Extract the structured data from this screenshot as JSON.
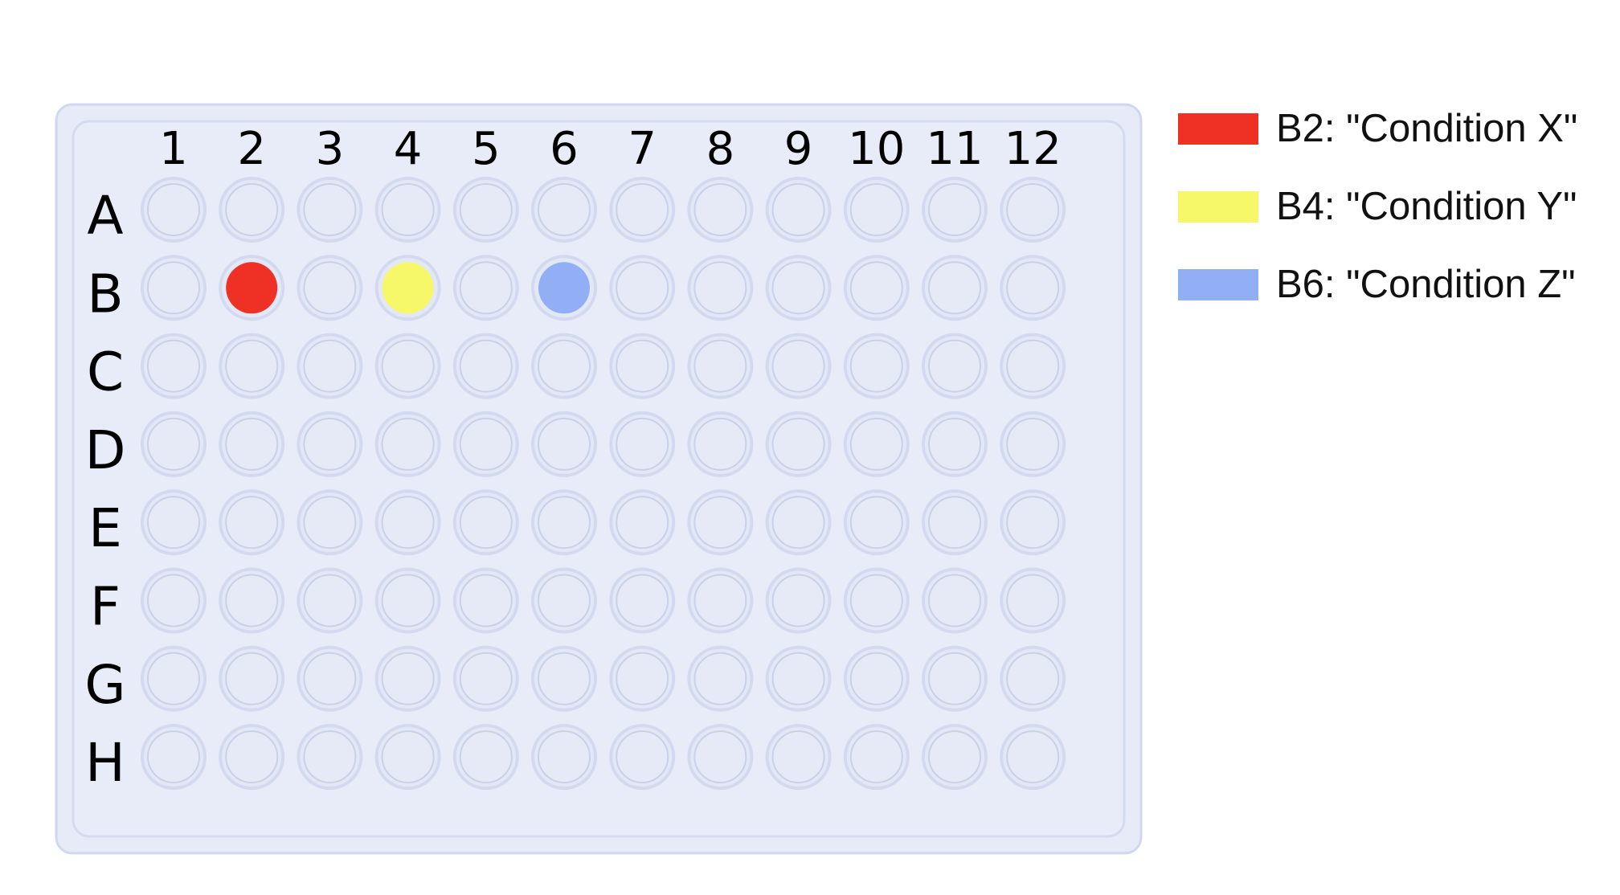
{
  "plate": {
    "columns": [
      "1",
      "2",
      "3",
      "4",
      "5",
      "6",
      "7",
      "8",
      "9",
      "10",
      "11",
      "12"
    ],
    "rows": [
      "A",
      "B",
      "C",
      "D",
      "E",
      "F",
      "G",
      "H"
    ],
    "empty_well_color": "#e6eaf6",
    "plate_color": "#e6ebf7",
    "plate_border_color": "#d0d8ee",
    "highlighted_wells": [
      {
        "well": "B2",
        "row": "B",
        "column": "2",
        "color": "#ee3124"
      },
      {
        "well": "B4",
        "row": "B",
        "column": "4",
        "color": "#f7f76a"
      },
      {
        "well": "B6",
        "row": "B",
        "column": "6",
        "color": "#92aff5"
      }
    ]
  },
  "legend": {
    "items": [
      {
        "label": "B2: \"Condition X\"",
        "color": "#ee3124"
      },
      {
        "label": "B4: \"Condition Y\"",
        "color": "#f7f76a"
      },
      {
        "label": "B6: \"Condition Z\"",
        "color": "#92aff5"
      }
    ]
  }
}
